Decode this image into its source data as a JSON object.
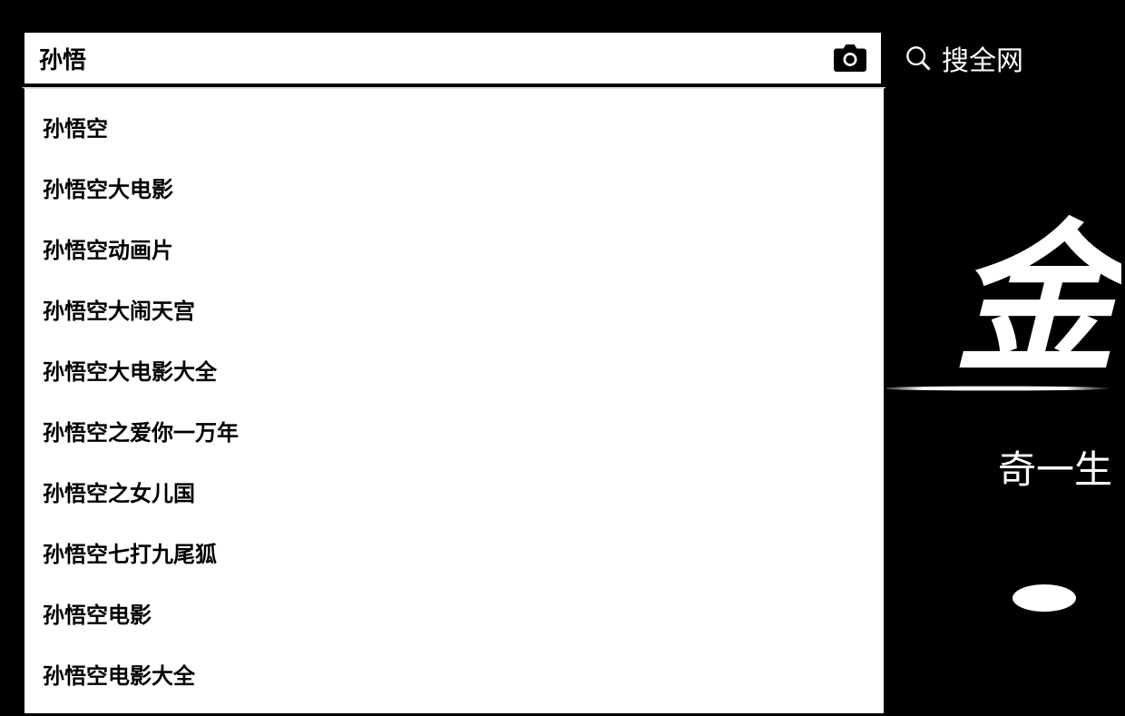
{
  "search": {
    "value": "孙悟",
    "placeholder": ""
  },
  "searchButton": {
    "label": "搜全网"
  },
  "suggestions": [
    "孙悟空",
    "孙悟空大电影",
    "孙悟空动画片",
    "孙悟空大闹天宫",
    "孙悟空大电影大全",
    "孙悟空之爱你一万年",
    "孙悟空之女儿国",
    "孙悟空七打九尾狐",
    "孙悟空电影",
    "孙悟空电影大全"
  ],
  "background": {
    "largeChar": "金",
    "smallText": "奇一生"
  }
}
